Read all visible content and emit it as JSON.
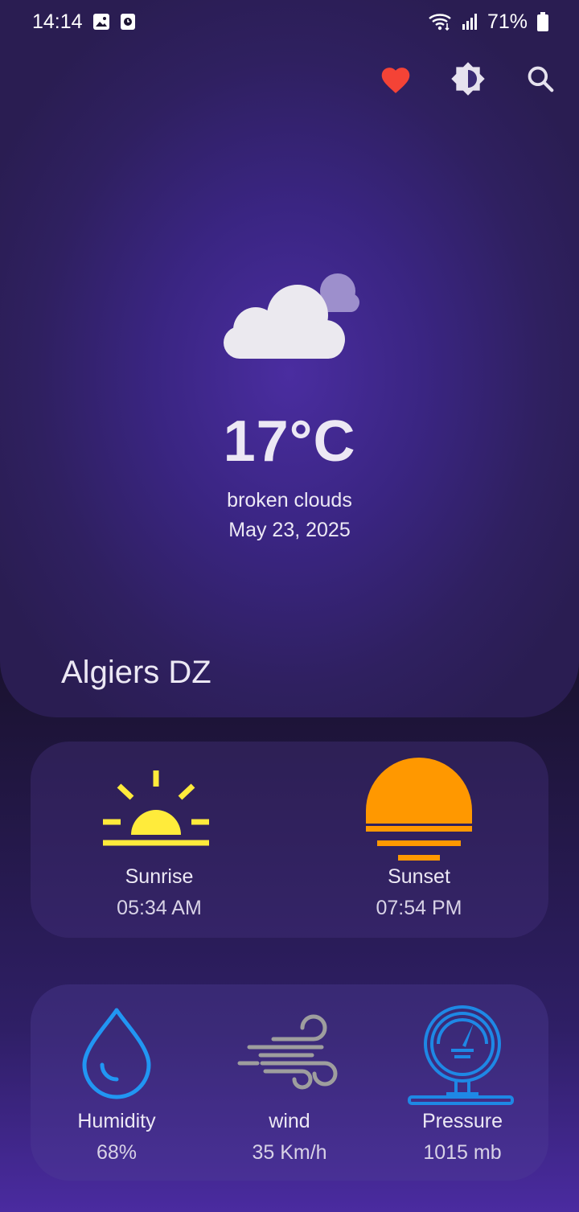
{
  "status_bar": {
    "time": "14:14",
    "battery": "71%",
    "icons": [
      "gallery-icon",
      "clock-notification-icon",
      "wifi-icon",
      "signal-icon",
      "battery-icon"
    ]
  },
  "actions": {
    "favorite_icon": "heart-icon",
    "theme_icon": "brightness-icon",
    "search_icon": "search-icon"
  },
  "current": {
    "icon": "broken-clouds-icon",
    "temperature": "17°C",
    "condition": "broken clouds",
    "date": "May 23, 2025",
    "city": "Algiers DZ"
  },
  "sun": {
    "sunrise_label": "Sunrise",
    "sunrise_time": "05:34 AM",
    "sunset_label": "Sunset",
    "sunset_time": "07:54 PM"
  },
  "stats": {
    "humidity_label": "Humidity",
    "humidity_value": "68%",
    "wind_label": "wind",
    "wind_value": "35 Km/h",
    "pressure_label": "Pressure",
    "pressure_value": "1015 mb"
  },
  "colors": {
    "heart": "#f44336",
    "sunrise": "#ffeb3b",
    "sunset": "#ff9800",
    "humidity": "#2196f3",
    "wind": "#9e9e9e",
    "pressure": "#1e88e5"
  }
}
